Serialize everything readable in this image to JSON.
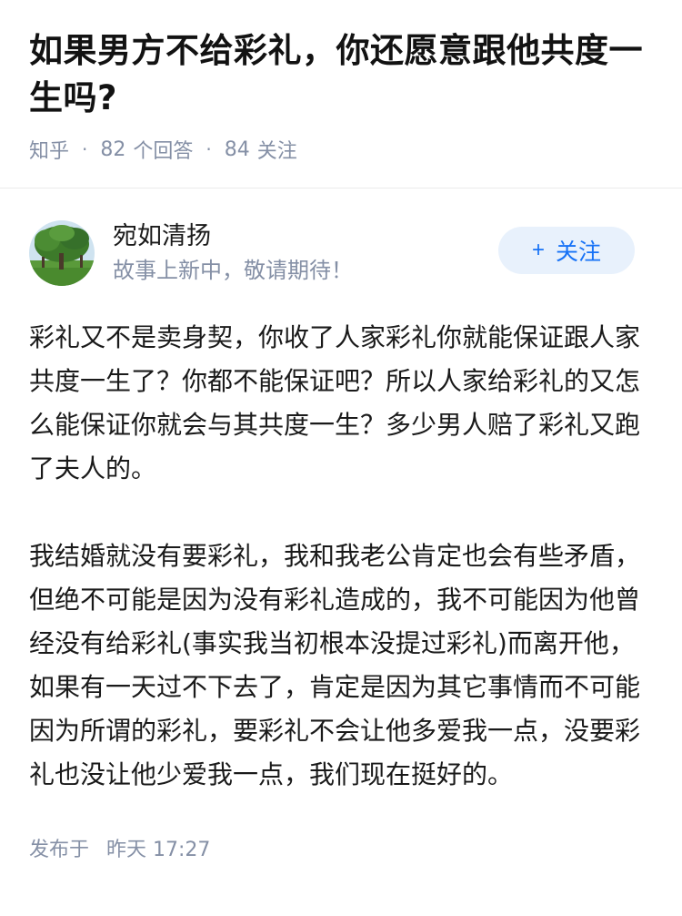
{
  "question": {
    "title": "如果男方不给彩礼，你还愿意跟他共度一生吗?",
    "source": "知乎",
    "answers_count": "82",
    "answers_label": "个回答",
    "followers_count": "84",
    "followers_label": "关注"
  },
  "answer": {
    "author_name": "宛如清扬",
    "author_bio": "故事上新中，敬请期待！",
    "follow_label": "关注",
    "paragraphs": [
      "彩礼又不是卖身契，你收了人家彩礼你就能保证跟人家共度一生了？你都不能保证吧？所以人家给彩礼的又怎么能保证你就会与其共度一生？多少男人赔了彩礼又跑了夫人的。",
      "我结婚就没有要彩礼，我和我老公肯定也会有些矛盾，但绝不可能是因为没有彩礼造成的，我不可能因为他曾经没有给彩礼(事实我当初根本没提过彩礼)而离开他，如果有一天过不下去了，肯定是因为其它事情而不可能因为所谓的彩礼，要彩礼不会让他多爱我一点，没要彩礼也没让他少爱我一点，我们现在挺好的。"
    ],
    "published_label": "发布于",
    "published_time": "昨天 17:27"
  },
  "colors": {
    "accent": "#1772f6",
    "follow_bg": "#e8f1fc",
    "meta_gray": "#8590a6"
  },
  "icons": {
    "follow": "plus-icon",
    "avatar": "tree-landscape-avatar"
  }
}
